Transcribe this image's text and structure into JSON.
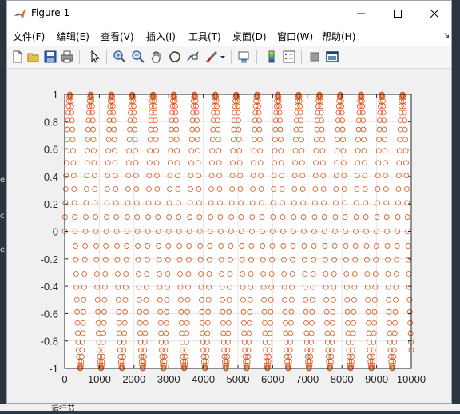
{
  "window": {
    "title": "Figure 1",
    "controls": {
      "minimize": "minimize",
      "maximize": "maximize",
      "close": "close"
    }
  },
  "menu": {
    "items": [
      {
        "label": "文件(F)"
      },
      {
        "label": "编辑(E)"
      },
      {
        "label": "查看(V)"
      },
      {
        "label": "插入(I)"
      },
      {
        "label": "工具(T)"
      },
      {
        "label": "桌面(D)"
      },
      {
        "label": "窗口(W)"
      },
      {
        "label": "帮助(H)"
      }
    ]
  },
  "toolbar": {
    "buttons": [
      {
        "icon": "new-figure-icon"
      },
      {
        "icon": "open-file-icon"
      },
      {
        "icon": "save-icon"
      },
      {
        "icon": "print-icon"
      },
      {
        "icon": "edit-plot-arrow-icon"
      },
      {
        "icon": "zoom-in-icon"
      },
      {
        "icon": "zoom-out-icon"
      },
      {
        "icon": "pan-hand-icon"
      },
      {
        "icon": "rotate-3d-icon"
      },
      {
        "icon": "data-cursor-icon"
      },
      {
        "icon": "brush-icon"
      },
      {
        "icon": "link-plot-icon"
      },
      {
        "icon": "colorbar-icon"
      },
      {
        "icon": "legend-icon"
      },
      {
        "icon": "hide-plot-tools-icon"
      },
      {
        "icon": "show-plot-tools-icon"
      }
    ]
  },
  "background": {
    "taskbar_text": "运行节"
  },
  "colors": {
    "marker": "#d95319",
    "axes_background": "#ffffff",
    "figure_background": "#f0f0f0"
  },
  "chart_data": {
    "type": "scatter",
    "marker": "circle",
    "series": [
      {
        "function": "sin",
        "x_start": 0,
        "x_end": 10000,
        "x_step": 10,
        "period": 600,
        "amplitude": 1
      }
    ],
    "xlim": [
      0,
      10000
    ],
    "ylim": [
      -1,
      1
    ],
    "x_ticks": [
      "0",
      "1000",
      "2000",
      "3000",
      "4000",
      "5000",
      "6000",
      "7000",
      "8000",
      "9000",
      "10000"
    ],
    "y_ticks": [
      "1",
      "0.8",
      "0.6",
      "0.4",
      "0.2",
      "0",
      "-0.2",
      "-0.4",
      "-0.6",
      "-0.8",
      "-1"
    ],
    "grid": true,
    "title": "",
    "xlabel": "",
    "ylabel": ""
  }
}
